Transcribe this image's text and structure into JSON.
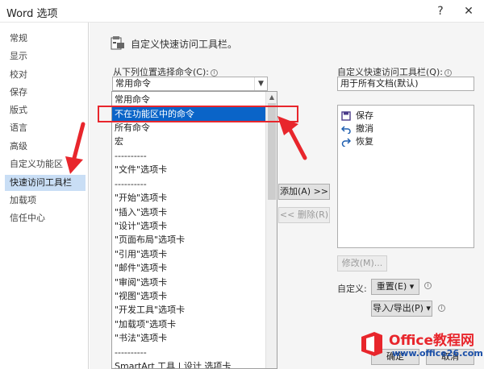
{
  "window": {
    "title": "Word 选项",
    "help_label": "?",
    "close_label": "✕"
  },
  "nav": {
    "items": [
      {
        "label": "常规"
      },
      {
        "label": "显示"
      },
      {
        "label": "校对"
      },
      {
        "label": "保存"
      },
      {
        "label": "版式"
      },
      {
        "label": "语言"
      },
      {
        "label": "高级"
      },
      {
        "label": "自定义功能区"
      },
      {
        "label": "快速访问工具栏",
        "active": true
      },
      {
        "label": "加载项"
      },
      {
        "label": "信任中心"
      }
    ]
  },
  "section": {
    "title": "自定义快速访问工具栏。",
    "icon": "toolbar-icon"
  },
  "commands": {
    "label": "从下列位置选择命令(C):",
    "selected": "常用命令",
    "options": [
      "常用命令",
      "不在功能区中的命令",
      "所有命令",
      "宏",
      "----------",
      "\"文件\"选项卡",
      "----------",
      "\"开始\"选项卡",
      "\"插入\"选项卡",
      "\"设计\"选项卡",
      "\"页面布局\"选项卡",
      "\"引用\"选项卡",
      "\"邮件\"选项卡",
      "\"审阅\"选项卡",
      "\"视图\"选项卡",
      "\"开发工具\"选项卡",
      "\"加载项\"选项卡",
      "\"书法\"选项卡",
      "----------",
      "SmartArt 工具 | 设计 选项卡"
    ],
    "highlighted_index": 1
  },
  "toolbar": {
    "label": "自定义快速访问工具栏(Q):",
    "selected": "用于所有文档(默认)",
    "items": [
      {
        "label": "保存",
        "icon": "save-icon"
      },
      {
        "label": "撤消",
        "icon": "undo-icon"
      },
      {
        "label": "恢复",
        "icon": "redo-icon"
      }
    ]
  },
  "buttons": {
    "add": "添加(A) >>",
    "remove": "<< 删除(R)",
    "modify": "修改(M)...",
    "customize_label": "自定义:",
    "reset": "重置(E) ▾",
    "import_export": "导入/导出(P) ▾",
    "ok": "确定",
    "cancel": "取消"
  },
  "watermark": {
    "brand": "Office教程网",
    "url": "www.office26.com"
  },
  "colors": {
    "accent": "#0a64c8",
    "annotation": "#e8262c",
    "active_nav": "#c9def5"
  }
}
